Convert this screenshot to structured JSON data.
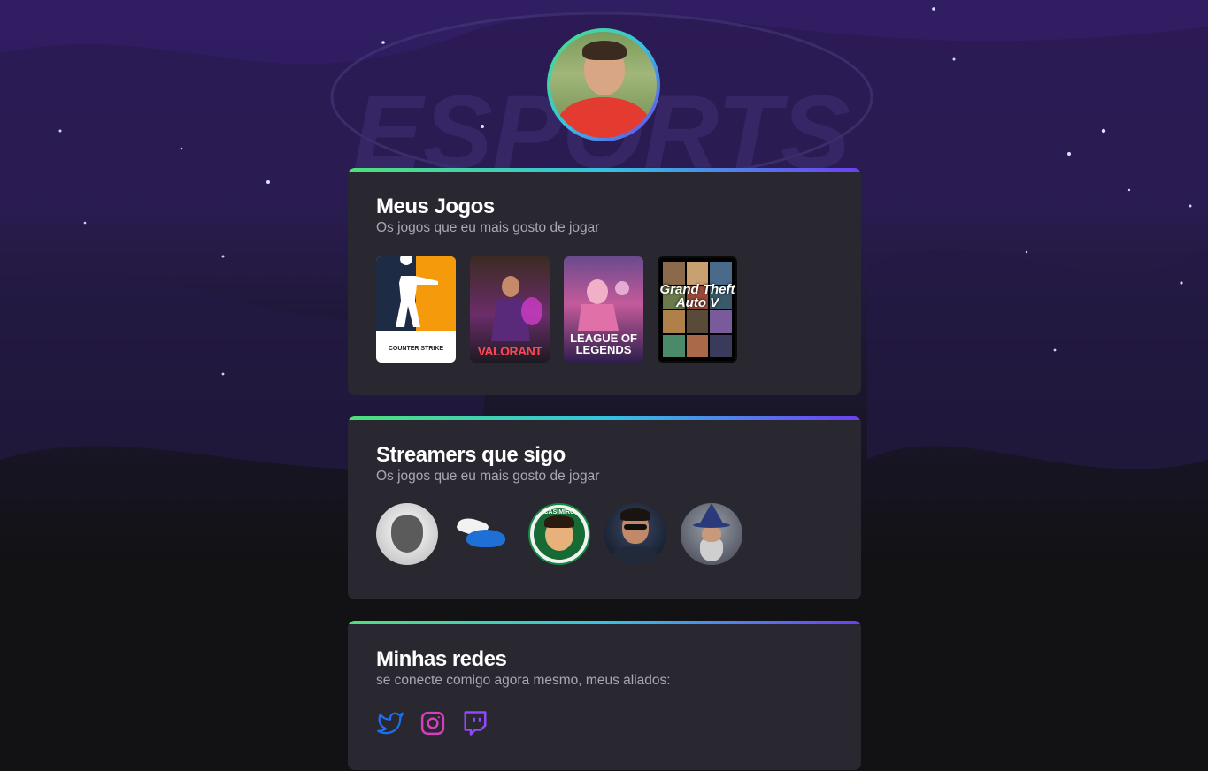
{
  "profile": {
    "avatar_icon": "profile-photo"
  },
  "background": {
    "watermark_text": "ESPORTS"
  },
  "games_section": {
    "title": "Meus Jogos",
    "subtitle": "Os jogos que eu mais gosto de jogar",
    "games": [
      {
        "name": "counter-strike",
        "label": "COUNTER STRIKE"
      },
      {
        "name": "valorant",
        "label": "VALORANT"
      },
      {
        "name": "league-of-legends",
        "label": "LEAGUE OF LEGENDS"
      },
      {
        "name": "grand-theft-auto-v",
        "label": "Grand Theft Auto V"
      }
    ]
  },
  "streamers_section": {
    "title": "Streamers que sigo",
    "subtitle": "Os jogos que eu mais gosto de jogar",
    "streamers": [
      {
        "icon": "tiger-logo"
      },
      {
        "icon": "winged-shoe-logo"
      },
      {
        "icon": "casimiro-logo",
        "label": "CASIMIRO"
      },
      {
        "icon": "streamer-portrait"
      },
      {
        "icon": "wizard-portrait"
      }
    ]
  },
  "social_section": {
    "title": "Minhas redes",
    "subtitle": "se conecte comigo agora mesmo, meus aliados:",
    "links": [
      {
        "icon": "twitter-icon",
        "color": "#1d6ff2"
      },
      {
        "icon": "instagram-icon",
        "color": "#d53fbf"
      },
      {
        "icon": "twitch-icon",
        "color": "#9146ff"
      }
    ]
  },
  "colors": {
    "background": "#121214",
    "card": "#29272f",
    "accent_gradient": [
      "#4fe07a",
      "#35c3e0",
      "#6d3ff2"
    ],
    "title": "#ffffff",
    "subtitle": "#a8a8b3"
  }
}
